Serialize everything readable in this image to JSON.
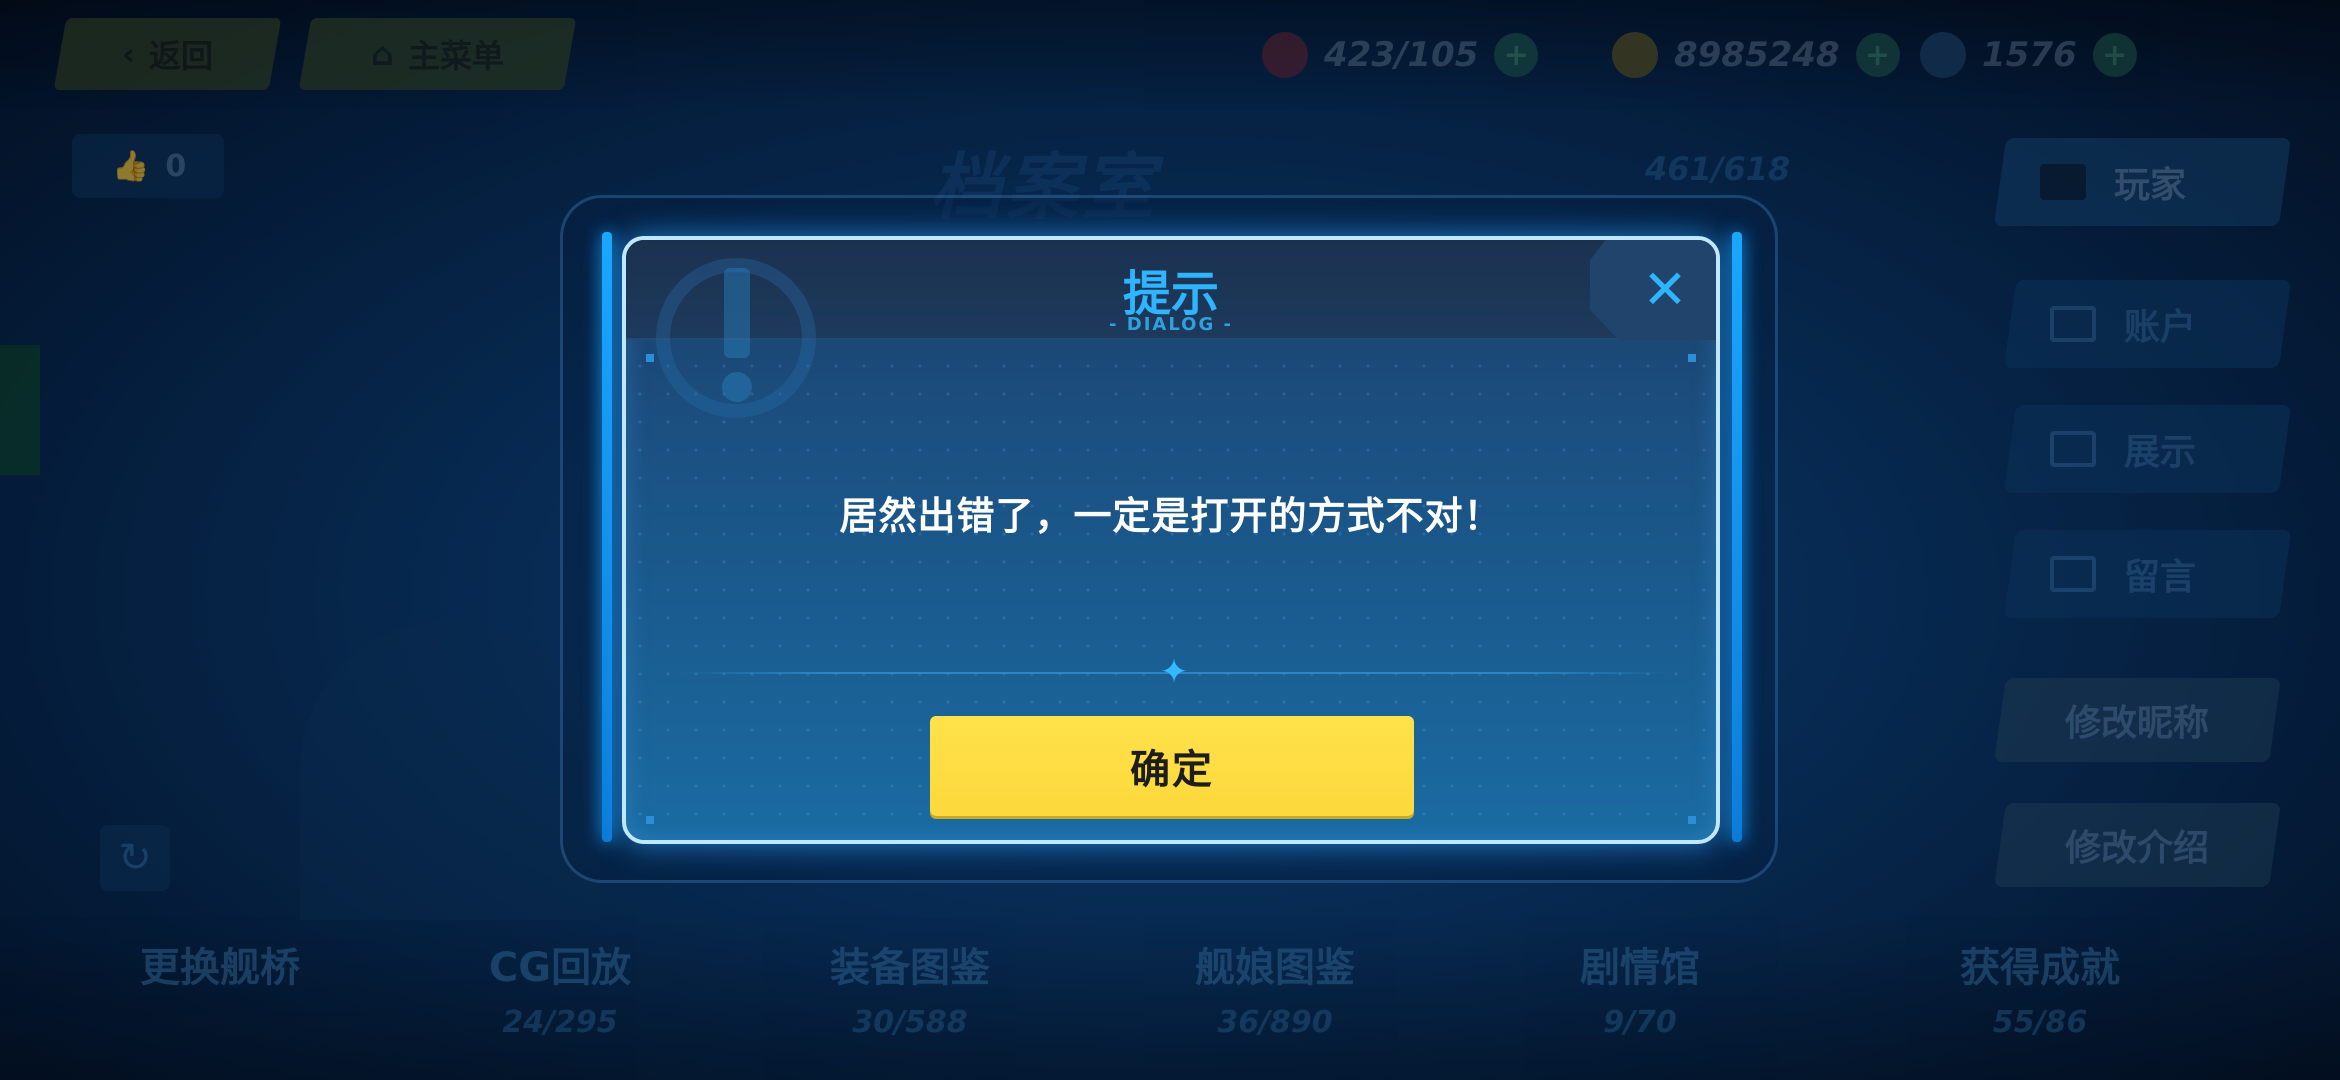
{
  "topbar": {
    "back_label": "返回",
    "menu_label": "主菜单",
    "resources": [
      {
        "icon": "ruby-icon",
        "value": "423/105"
      },
      {
        "icon": "coin-icon",
        "value": "8985248"
      },
      {
        "icon": "crystal-icon",
        "value": "1576"
      }
    ]
  },
  "background": {
    "likes": "0",
    "title": "档案室",
    "count": "461/618",
    "side_buttons": [
      "玩家",
      "账户",
      "展示",
      "留言"
    ],
    "action_buttons": [
      "修改昵称",
      "修改介绍"
    ],
    "tabs": [
      {
        "label": "更换舰桥",
        "count": ""
      },
      {
        "label": "CG回放",
        "count": "24/295"
      },
      {
        "label": "装备图鉴",
        "count": "30/588"
      },
      {
        "label": "舰娘图鉴",
        "count": "36/890"
      },
      {
        "label": "剧情馆",
        "count": "9/70"
      },
      {
        "label": "获得成就",
        "count": "55/86"
      }
    ]
  },
  "dialog": {
    "title": "提示",
    "subtitle": "- DIALOG -",
    "message": "居然出错了，一定是打开的方式不对！",
    "confirm_label": "确定",
    "close_icon": "close-icon"
  },
  "colors": {
    "accent": "#2fb4ff",
    "confirm": "#ffe14a",
    "frame": "#bfe8ff"
  }
}
